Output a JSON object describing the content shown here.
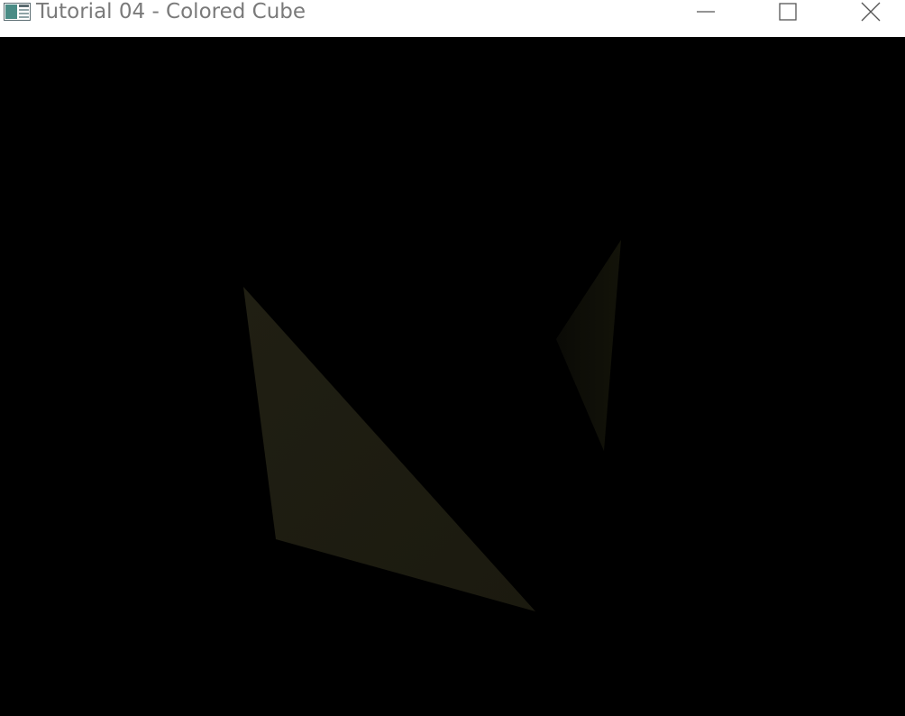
{
  "window": {
    "title": "Tutorial 04 - Colored Cube",
    "icons": {
      "app": "app-window-icon",
      "minimize": "minimize-icon",
      "maximize": "maximize-icon",
      "close": "close-icon"
    }
  },
  "scene": {
    "background_color": "#000000",
    "colors": {
      "large_face": "#1c1b10",
      "small_face": "#0d0d07"
    }
  }
}
